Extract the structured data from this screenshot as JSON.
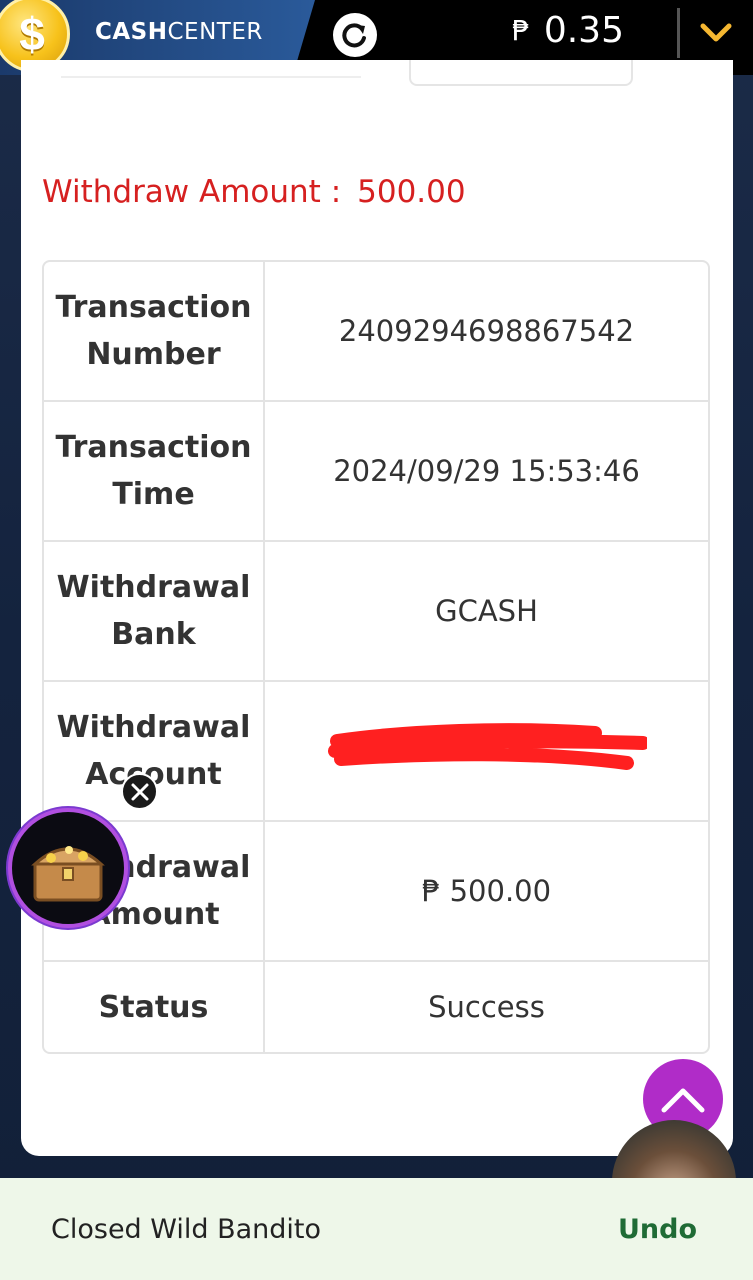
{
  "header": {
    "coin_symbol": "$",
    "brand_bold": "CASH",
    "brand_rest": "CENTER",
    "currency_symbol": "₱",
    "balance": "0.35"
  },
  "withdraw": {
    "label": "Withdraw Amount :",
    "value": "500.00"
  },
  "transaction": {
    "rows": [
      {
        "key": "Transaction Number",
        "value": "2409294698867542"
      },
      {
        "key": "Transaction Time",
        "value": "2024/09/29 15:53:46"
      },
      {
        "key": "Withdrawal Bank",
        "value": "GCASH"
      },
      {
        "key": "Withdrawal Account",
        "value": ""
      },
      {
        "key": "Withdrawal Amount",
        "value": "₱ 500.00"
      },
      {
        "key": "Status",
        "value": "Success"
      }
    ]
  },
  "snackbar": {
    "message": "Closed Wild Bandito",
    "action": "Undo"
  },
  "colors": {
    "withdraw_red": "#d62020",
    "up_button": "#b02cc8",
    "undo_green": "#1f6b35",
    "redaction": "#ff2020"
  },
  "icons": [
    "coin-icon",
    "refresh-icon",
    "chevron-down-icon",
    "treasure-chest-icon",
    "close-icon",
    "chevron-up-icon",
    "avatar"
  ]
}
